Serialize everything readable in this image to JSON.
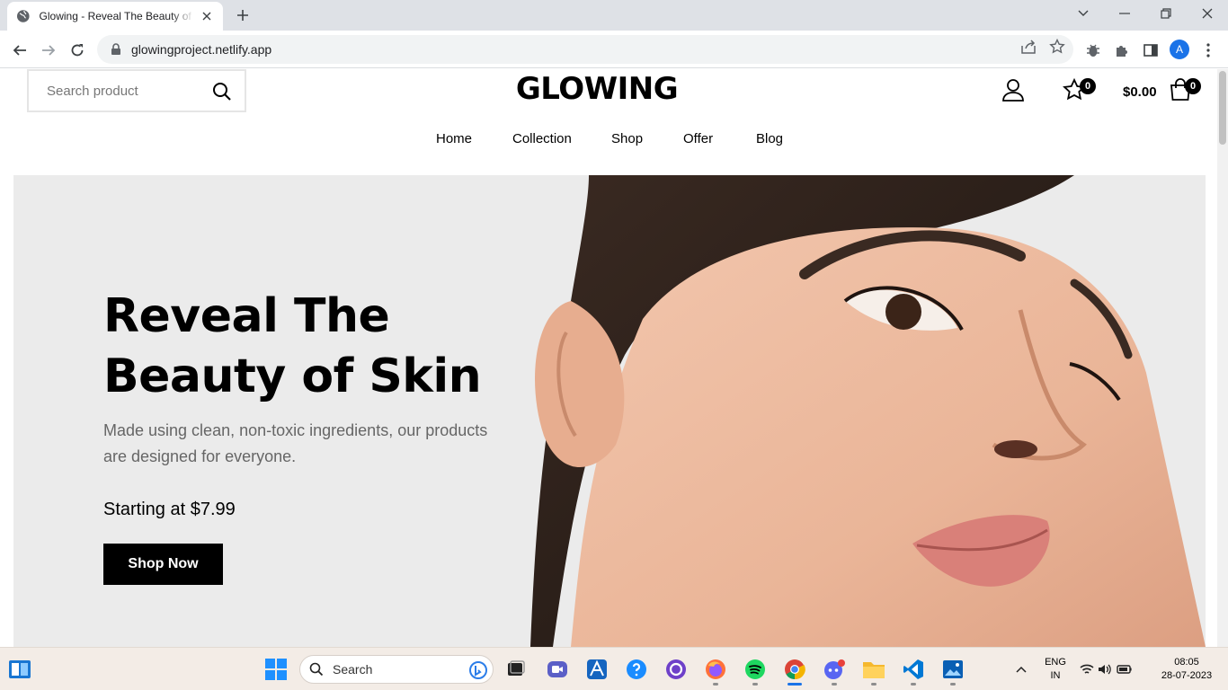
{
  "browser": {
    "tab_title": "Glowing - Reveal The Beauty of Skin",
    "url": "glowingproject.netlify.app",
    "profile_initial": "A"
  },
  "header": {
    "search_placeholder": "Search product",
    "logo": "GLOWING",
    "wishlist_count": "0",
    "cart_total": "$0.00",
    "cart_count": "0"
  },
  "nav": {
    "items": [
      {
        "label": "Home"
      },
      {
        "label": "Collection"
      },
      {
        "label": "Shop"
      },
      {
        "label": "Offer"
      },
      {
        "label": "Blog"
      }
    ]
  },
  "hero": {
    "title_line1": "Reveal The",
    "title_line2": "Beauty of Skin",
    "description": "Made using clean, non-toxic ingredients, our products are designed for everyone.",
    "price_text": "Starting at $7.99",
    "cta_label": "Shop Now"
  },
  "taskbar": {
    "search_label": "Search",
    "lang_line1": "ENG",
    "lang_line2": "IN",
    "time": "08:05",
    "date": "28-07-2023"
  },
  "colors": {
    "accent_black": "#000000",
    "hero_bg": "#ebebeb",
    "chrome_bg": "#dee1e6",
    "taskbar_bg": "#f3ece6"
  }
}
